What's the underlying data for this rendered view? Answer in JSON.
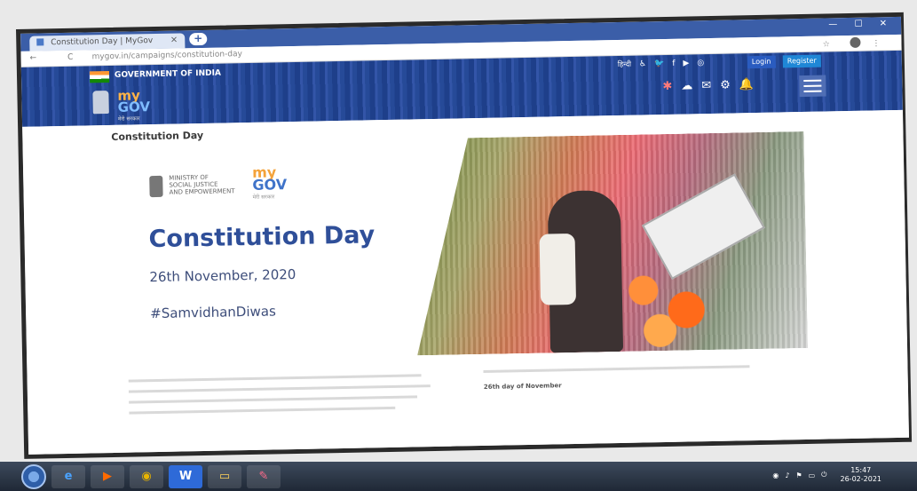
{
  "browser": {
    "tab_title": "Constitution Day | MyGov",
    "tab_close": "×",
    "new_tab": "+",
    "url": "mygov.in/campaigns/constitution-day",
    "nav": [
      "←",
      "C"
    ],
    "star": "☆"
  },
  "header": {
    "govt_label": "GOVERNMENT OF INDIA",
    "logo_my": "my",
    "logo_gov": "GOV",
    "logo_sub": "मेरी सरकार",
    "lang": "हिन्दी",
    "social_icons": [
      "♿",
      "🐦",
      "f",
      "▶",
      "◎"
    ],
    "login": "Login",
    "register": "Register",
    "menu_icons": [
      "✱",
      "☁",
      "✉",
      "⚙",
      "🔔"
    ]
  },
  "content": {
    "breadcrumb": "Constitution Day",
    "ministry_line1": "MINISTRY OF",
    "ministry_line2": "SOCIAL JUSTICE",
    "ministry_line3": "AND EMPOWERMENT",
    "mygov_my": "my",
    "mygov_gov": "GOV",
    "mygov_sub": "मेरी सरकार",
    "title": "Constitution Day",
    "date": "26th November, 2020",
    "hashtag": "#SamvidhanDiwas",
    "para_right_highlight": "26th day of November"
  },
  "taskbar": {
    "ie": "e",
    "media": "▶",
    "chrome": "◉",
    "word": "W",
    "files": "▭",
    "paint": "✎",
    "time": "15:47",
    "date": "26-02-2021"
  }
}
